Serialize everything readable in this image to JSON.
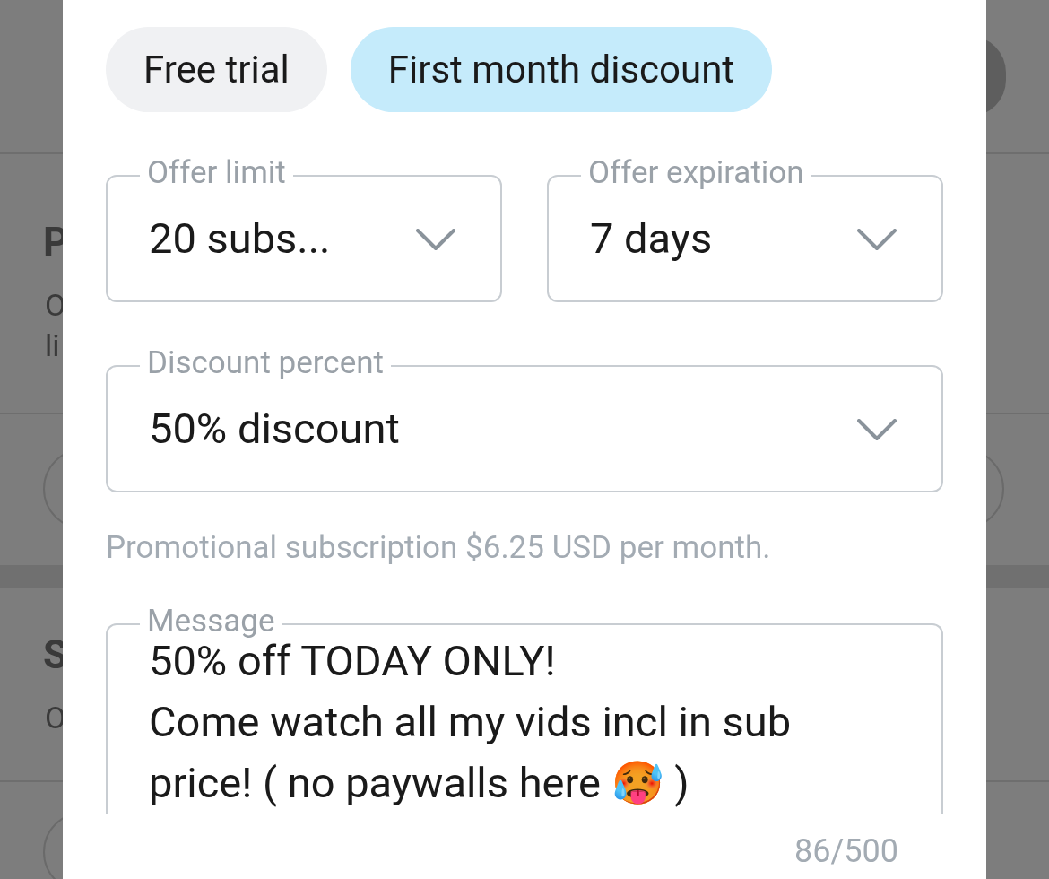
{
  "background_page": [
    {
      "text": "P",
      "bold": true
    },
    {
      "text": "O",
      "bold": false
    },
    {
      "text": "li",
      "bold": false
    },
    {
      "text": "S",
      "bold": true
    },
    {
      "text": "O",
      "bold": false
    }
  ],
  "tabs": [
    {
      "label": "Free trial",
      "selected": false
    },
    {
      "label": "First month discount",
      "selected": true
    }
  ],
  "fields": [
    {
      "label": "Offer limit",
      "value": "20 subs..."
    },
    {
      "label": "Offer expiration",
      "value": "7 days"
    },
    {
      "label": "Discount percent",
      "value": "50% discount"
    }
  ],
  "helper_text": "Promotional subscription $6.25 USD per month.",
  "message": {
    "label": "Message",
    "value": "50% off TODAY ONLY!\nCome watch all my vids incl in sub price! ( no paywalls here 🥵 )"
  },
  "counter": "86/500"
}
